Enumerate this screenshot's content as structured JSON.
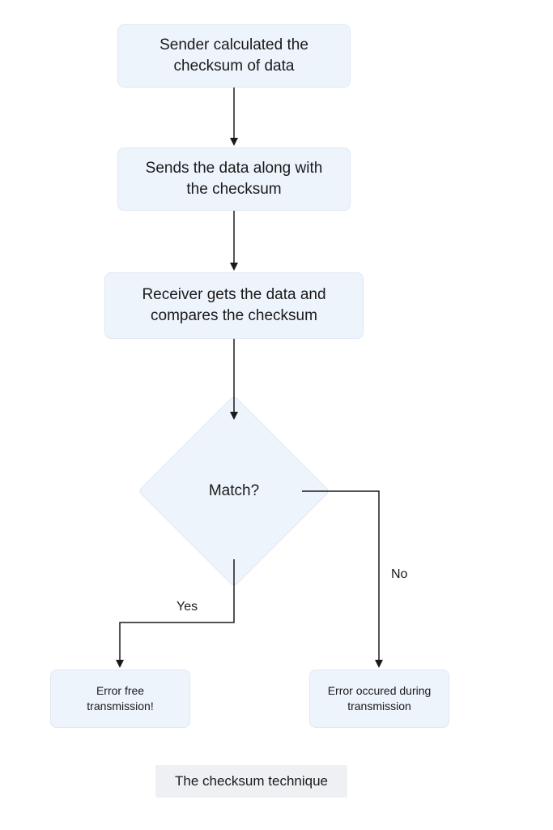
{
  "nodes": {
    "step1": "Sender calculated the checksum of data",
    "step2": "Sends the data along with the checksum",
    "step3": "Receiver gets the data and compares the checksum",
    "decision": "Match?",
    "result_yes": "Error free transmission!",
    "result_no": "Error occured during transmission"
  },
  "edges": {
    "yes": "Yes",
    "no": "No"
  },
  "caption": "The checksum technique"
}
